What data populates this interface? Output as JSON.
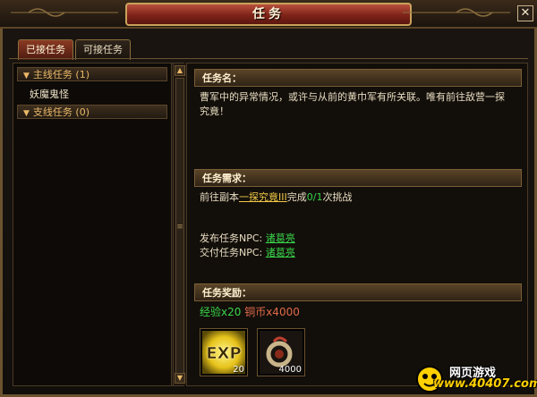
{
  "window": {
    "title": "任务",
    "close_glyph": "✕"
  },
  "tabs": [
    {
      "label": "已接任务",
      "active": true
    },
    {
      "label": "可接任务",
      "active": false
    }
  ],
  "quest_list": {
    "categories": [
      {
        "label": "主线任务",
        "count": "(1)"
      },
      {
        "label": "支线任务",
        "count": "(0)"
      }
    ],
    "items": [
      {
        "label": "妖魔鬼怪"
      }
    ]
  },
  "detail": {
    "name_header": "任务名：",
    "description": "曹军中的异常情况，或许与从前的黄巾军有所关联。唯有前往敌营一探究竟！",
    "requirement_header": "任务需求：",
    "requirement": {
      "prefix": "前往副本",
      "dungeon": "一探究竟III",
      "mid": "完成",
      "progress": "0/1",
      "suffix": "次挑战"
    },
    "publisher_label": "发布任务NPC:",
    "publisher_npc": "诸葛亮",
    "submit_label": "交付任务NPC:",
    "submit_npc": "诸葛亮",
    "rewards_header": "任务奖励：",
    "reward_exp": "经验x20",
    "reward_coin": "铜币x4000",
    "reward_icons": [
      {
        "icon": "exp-icon",
        "label": "EXP",
        "count": "20"
      },
      {
        "icon": "coin-pouch-icon",
        "count": "4000"
      }
    ]
  },
  "watermark": {
    "site_name": "网页游戏",
    "url": "www.40407.com"
  },
  "colors": {
    "accent": "#e9b868",
    "link_green": "#39d64a",
    "link_yellow": "#f0c846",
    "title_red": "#7e2318"
  }
}
